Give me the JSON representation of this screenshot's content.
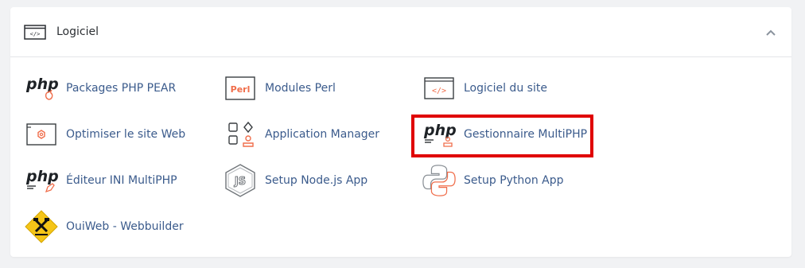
{
  "section": {
    "title": "Logiciel",
    "icon": "code-window-icon",
    "collapse_icon": "chevron-up-icon"
  },
  "items": [
    {
      "label": "Packages PHP PEAR",
      "icon": "php-pear-icon"
    },
    {
      "label": "Modules Perl",
      "icon": "perl-icon",
      "badge": "Perl"
    },
    {
      "label": "Logiciel du site",
      "icon": "code-window-icon"
    },
    {
      "label": "Optimiser le site Web",
      "icon": "optimize-site-icon"
    },
    {
      "label": "Application Manager",
      "icon": "application-manager-icon"
    },
    {
      "label": "Gestionnaire MultiPHP",
      "icon": "multiphp-manager-icon"
    },
    {
      "label": "Éditeur INI MultiPHP",
      "icon": "multiphp-ini-icon"
    },
    {
      "label": "Setup Node.js App",
      "icon": "nodejs-icon"
    },
    {
      "label": "Setup Python App",
      "icon": "python-icon"
    },
    {
      "label": "OuiWeb - Webbuilder",
      "icon": "webbuilder-icon"
    }
  ],
  "php_text": "php",
  "colors": {
    "accent": "#f06d4a",
    "link": "#3b5b8c",
    "highlight": "#e00000"
  }
}
